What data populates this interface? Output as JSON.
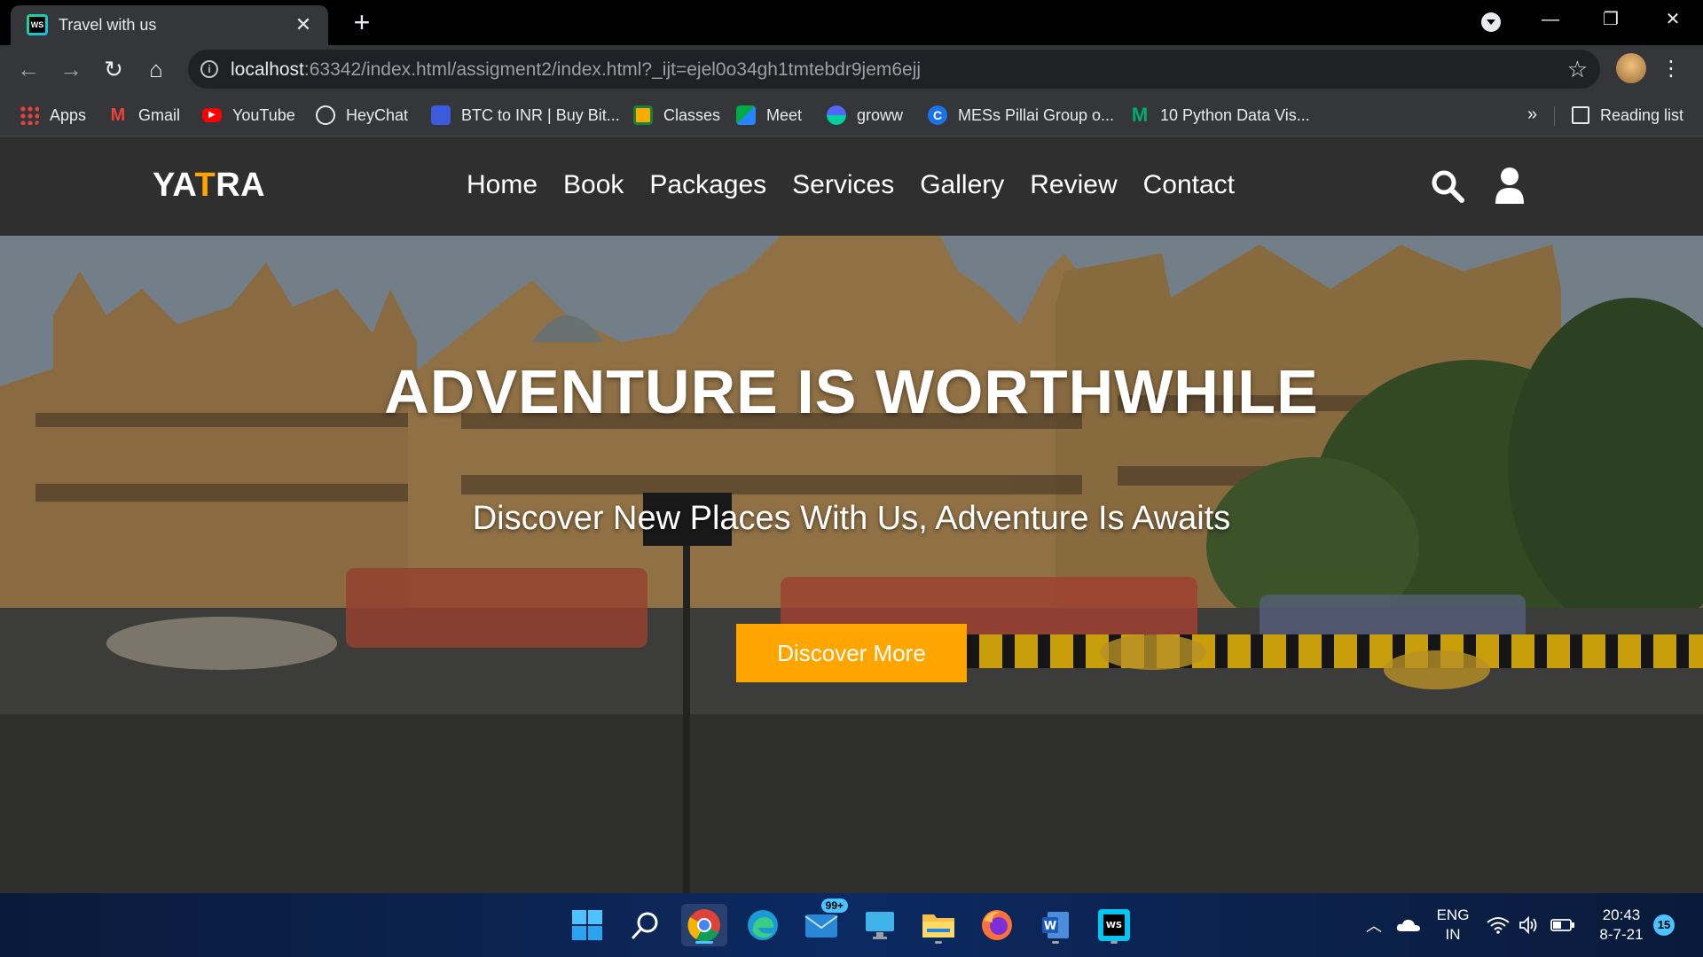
{
  "browser": {
    "tab_title": "Travel with us",
    "url_host": "localhost",
    "url_rest": ":63342/index.html/assigment2/index.html?_ijt=ejel0o34gh1tmtebdr9jem6ejj",
    "bookmarks": [
      {
        "label": "Apps",
        "icon": "apps-grid-icon"
      },
      {
        "label": "Gmail",
        "icon": "gmail-icon"
      },
      {
        "label": "YouTube",
        "icon": "youtube-icon"
      },
      {
        "label": "HeyChat",
        "icon": "globe-icon"
      },
      {
        "label": "BTC to INR | Buy Bit...",
        "icon": "chart-icon"
      },
      {
        "label": "Classes",
        "icon": "classroom-icon"
      },
      {
        "label": "Meet",
        "icon": "meet-icon"
      },
      {
        "label": "groww",
        "icon": "groww-icon"
      },
      {
        "label": "MESs Pillai Group o...",
        "icon": "c-logo-icon"
      },
      {
        "label": "10 Python Data Vis...",
        "icon": "medium-icon"
      }
    ],
    "more_label": "»",
    "reading_list": "Reading list"
  },
  "site": {
    "logo_pre": "YA",
    "logo_accent": "T",
    "logo_post": "RA",
    "nav": [
      "Home",
      "Book",
      "Packages",
      "Services",
      "Gallery",
      "Review",
      "Contact"
    ],
    "hero_title": "ADVENTURE IS WORTHWHILE",
    "hero_subtitle": "Discover New Places With Us, Adventure Is Awaits",
    "hero_button": "Discover More",
    "accent_color": "#ffa500"
  },
  "taskbar": {
    "mail_badge": "99+",
    "lang_1": "ENG",
    "lang_2": "IN",
    "time": "20:43",
    "date": "8-7-21",
    "notifications": "15"
  }
}
